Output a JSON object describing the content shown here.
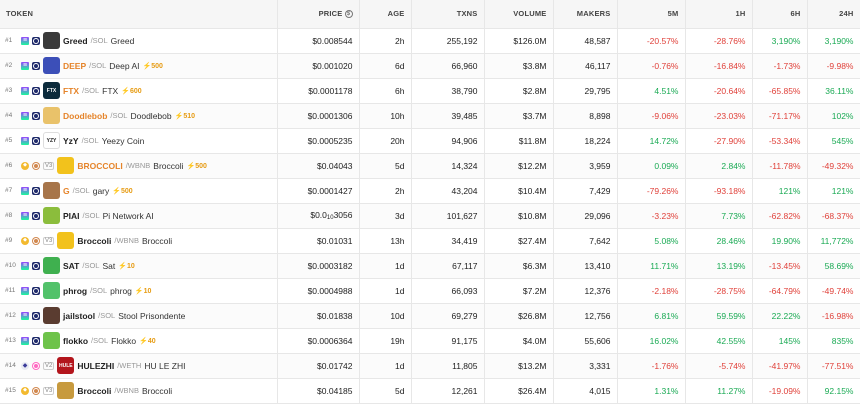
{
  "columns": {
    "token": "TOKEN",
    "price": "PRICE",
    "age": "AGE",
    "txns": "TXNS",
    "volume": "VOLUME",
    "makers": "MAKERS",
    "m5": "5M",
    "h1": "1H",
    "h6": "6H",
    "h24": "24H",
    "price_icon": "$"
  },
  "rows": [
    {
      "rank": "#1",
      "chain": "sol",
      "dex": "ray",
      "version": "",
      "avatar_text": "",
      "avatar_color": "#3a3a3a",
      "symbol": "Greed",
      "hot": false,
      "pair": "/SOL",
      "name": "Greed",
      "boost": "",
      "price": "$0.008544",
      "price_sub": "",
      "age": "2h",
      "txns": "255,192",
      "volume": "$126.0M",
      "makers": "48,587",
      "m5": "-20.57%",
      "m5_dir": "neg",
      "h1": "-28.76%",
      "h1_dir": "neg",
      "h6": "3,190%",
      "h6_dir": "pos",
      "h24": "3,190%",
      "h24_dir": "pos"
    },
    {
      "rank": "#2",
      "chain": "sol",
      "dex": "ray",
      "version": "",
      "avatar_text": "",
      "avatar_color": "#3c4fb8",
      "symbol": "DEEP",
      "hot": true,
      "pair": "/SOL",
      "name": "Deep AI",
      "boost": "500",
      "price": "$0.001020",
      "price_sub": "",
      "age": "6d",
      "txns": "66,960",
      "volume": "$3.8M",
      "makers": "46,117",
      "m5": "-0.76%",
      "m5_dir": "neg",
      "h1": "-16.84%",
      "h1_dir": "neg",
      "h6": "-1.73%",
      "h6_dir": "neg",
      "h24": "-9.98%",
      "h24_dir": "neg"
    },
    {
      "rank": "#3",
      "chain": "sol",
      "dex": "ray",
      "version": "",
      "avatar_text": "FTX",
      "avatar_color": "#0c2b3c",
      "symbol": "FTX",
      "hot": true,
      "pair": "/SOL",
      "name": "FTX",
      "boost": "600",
      "price": "$0.0001178",
      "price_sub": "",
      "age": "6h",
      "txns": "38,790",
      "volume": "$2.8M",
      "makers": "29,795",
      "m5": "4.51%",
      "m5_dir": "pos",
      "h1": "-20.64%",
      "h1_dir": "neg",
      "h6": "-65.85%",
      "h6_dir": "neg",
      "h24": "36.11%",
      "h24_dir": "pos"
    },
    {
      "rank": "#4",
      "chain": "sol",
      "dex": "ray",
      "version": "",
      "avatar_text": "",
      "avatar_color": "#e9c26a",
      "symbol": "Doodlebob",
      "hot": true,
      "pair": "/SOL",
      "name": "Doodlebob",
      "boost": "510",
      "price": "$0.0001306",
      "price_sub": "",
      "age": "10h",
      "txns": "39,485",
      "volume": "$3.7M",
      "makers": "8,898",
      "m5": "-9.06%",
      "m5_dir": "neg",
      "h1": "-23.03%",
      "h1_dir": "neg",
      "h6": "-71.17%",
      "h6_dir": "neg",
      "h24": "102%",
      "h24_dir": "pos"
    },
    {
      "rank": "#5",
      "chain": "sol",
      "dex": "ray",
      "version": "",
      "avatar_text": "YZY",
      "avatar_color": "#ffffff",
      "symbol": "YzY",
      "hot": false,
      "pair": "/SOL",
      "name": "Yeezy Coin",
      "boost": "",
      "price": "$0.0005235",
      "price_sub": "",
      "age": "20h",
      "txns": "94,906",
      "volume": "$11.8M",
      "makers": "18,224",
      "m5": "14.72%",
      "m5_dir": "pos",
      "h1": "-27.90%",
      "h1_dir": "neg",
      "h6": "-53.34%",
      "h6_dir": "neg",
      "h24": "545%",
      "h24_dir": "pos"
    },
    {
      "rank": "#6",
      "chain": "bnb",
      "dex": "pancake",
      "version": "V3",
      "avatar_text": "",
      "avatar_color": "#f2c21c",
      "symbol": "BROCCOLI",
      "hot": true,
      "pair": "/WBNB",
      "name": "Broccoli",
      "boost": "500",
      "price": "$0.04043",
      "price_sub": "",
      "age": "5d",
      "txns": "14,324",
      "volume": "$12.2M",
      "makers": "3,959",
      "m5": "0.09%",
      "m5_dir": "pos",
      "h1": "2.84%",
      "h1_dir": "pos",
      "h6": "-11.78%",
      "h6_dir": "neg",
      "h24": "-49.32%",
      "h24_dir": "neg"
    },
    {
      "rank": "#7",
      "chain": "sol",
      "dex": "ray",
      "version": "",
      "avatar_text": "",
      "avatar_color": "#a7754a",
      "symbol": "G",
      "hot": true,
      "pair": "/SOL",
      "name": "gary",
      "boost": "500",
      "price": "$0.0001427",
      "price_sub": "",
      "age": "2h",
      "txns": "43,204",
      "volume": "$10.4M",
      "makers": "7,429",
      "m5": "-79.26%",
      "m5_dir": "neg",
      "h1": "-93.18%",
      "h1_dir": "neg",
      "h6": "121%",
      "h6_dir": "pos",
      "h24": "121%",
      "h24_dir": "pos"
    },
    {
      "rank": "#8",
      "chain": "sol",
      "dex": "ray",
      "version": "",
      "avatar_text": "",
      "avatar_color": "#8bbd3c",
      "symbol": "PIAI",
      "hot": false,
      "pair": "/SOL",
      "name": "Pi Network AI",
      "boost": "",
      "price": "$0.0",
      "price_sub": "10",
      "price_tail": "3056",
      "age": "3d",
      "txns": "101,627",
      "volume": "$10.8M",
      "makers": "29,096",
      "m5": "-3.23%",
      "m5_dir": "neg",
      "h1": "7.73%",
      "h1_dir": "pos",
      "h6": "-62.82%",
      "h6_dir": "neg",
      "h24": "-68.37%",
      "h24_dir": "neg"
    },
    {
      "rank": "#9",
      "chain": "bnb",
      "dex": "pancake",
      "version": "V3",
      "avatar_text": "",
      "avatar_color": "#f2c21c",
      "symbol": "Broccoli",
      "hot": false,
      "pair": "/WBNB",
      "name": "Broccoli",
      "boost": "",
      "price": "$0.01031",
      "price_sub": "",
      "age": "13h",
      "txns": "34,419",
      "volume": "$27.4M",
      "makers": "7,642",
      "m5": "5.08%",
      "m5_dir": "pos",
      "h1": "28.46%",
      "h1_dir": "pos",
      "h6": "19.90%",
      "h6_dir": "pos",
      "h24": "11,772%",
      "h24_dir": "pos"
    },
    {
      "rank": "#10",
      "chain": "sol",
      "dex": "ray",
      "version": "",
      "avatar_text": "",
      "avatar_color": "#3fb04f",
      "symbol": "SAT",
      "hot": false,
      "pair": "/SOL",
      "name": "Sat",
      "boost": "10",
      "price": "$0.0003182",
      "price_sub": "",
      "age": "1d",
      "txns": "67,117",
      "volume": "$6.3M",
      "makers": "13,410",
      "m5": "11.71%",
      "m5_dir": "pos",
      "h1": "13.19%",
      "h1_dir": "pos",
      "h6": "-13.45%",
      "h6_dir": "neg",
      "h24": "58.69%",
      "h24_dir": "pos"
    },
    {
      "rank": "#11",
      "chain": "sol",
      "dex": "ray",
      "version": "",
      "avatar_text": "",
      "avatar_color": "#52c26a",
      "symbol": "phrog",
      "hot": false,
      "pair": "/SOL",
      "name": "phrog",
      "boost": "10",
      "price": "$0.0004988",
      "price_sub": "",
      "age": "1d",
      "txns": "66,093",
      "volume": "$7.2M",
      "makers": "12,376",
      "m5": "-2.18%",
      "m5_dir": "neg",
      "h1": "-28.75%",
      "h1_dir": "neg",
      "h6": "-64.79%",
      "h6_dir": "neg",
      "h24": "-49.74%",
      "h24_dir": "neg"
    },
    {
      "rank": "#12",
      "chain": "sol",
      "dex": "ray",
      "version": "",
      "avatar_text": "",
      "avatar_color": "#5a3c30",
      "symbol": "jailstool",
      "hot": false,
      "pair": "/SOL",
      "name": "Stool Prisondente",
      "boost": "",
      "price": "$0.01838",
      "price_sub": "",
      "age": "10d",
      "txns": "69,279",
      "volume": "$26.8M",
      "makers": "12,756",
      "m5": "6.81%",
      "m5_dir": "pos",
      "h1": "59.59%",
      "h1_dir": "pos",
      "h6": "22.22%",
      "h6_dir": "pos",
      "h24": "-16.98%",
      "h24_dir": "neg"
    },
    {
      "rank": "#13",
      "chain": "sol",
      "dex": "ray",
      "version": "",
      "avatar_text": "",
      "avatar_color": "#6ec34a",
      "symbol": "flokko",
      "hot": false,
      "pair": "/SOL",
      "name": "Flokko",
      "boost": "40",
      "price": "$0.0006364",
      "price_sub": "",
      "age": "19h",
      "txns": "91,175",
      "volume": "$4.0M",
      "makers": "55,606",
      "m5": "16.02%",
      "m5_dir": "pos",
      "h1": "42.55%",
      "h1_dir": "pos",
      "h6": "145%",
      "h6_dir": "pos",
      "h24": "835%",
      "h24_dir": "pos"
    },
    {
      "rank": "#14",
      "chain": "eth",
      "dex": "uni",
      "version": "V2",
      "avatar_text": "HULE",
      "avatar_color": "#b3151c",
      "symbol": "HULEZHI",
      "hot": false,
      "pair": "/WETH",
      "name": "HU LE ZHI",
      "boost": "",
      "price": "$0.01742",
      "price_sub": "",
      "age": "1d",
      "txns": "11,805",
      "volume": "$13.2M",
      "makers": "3,331",
      "m5": "-1.76%",
      "m5_dir": "neg",
      "h1": "-5.74%",
      "h1_dir": "neg",
      "h6": "-41.97%",
      "h6_dir": "neg",
      "h24": "-77.51%",
      "h24_dir": "neg"
    },
    {
      "rank": "#15",
      "chain": "bnb",
      "dex": "pancake",
      "version": "V3",
      "avatar_text": "",
      "avatar_color": "#c79a3e",
      "symbol": "Broccoli",
      "hot": false,
      "pair": "/WBNB",
      "name": "Broccoli",
      "boost": "",
      "price": "$0.04185",
      "price_sub": "",
      "age": "5d",
      "txns": "12,261",
      "volume": "$26.4M",
      "makers": "4,015",
      "m5": "1.31%",
      "m5_dir": "pos",
      "h1": "11.27%",
      "h1_dir": "pos",
      "h6": "-19.09%",
      "h6_dir": "neg",
      "h24": "92.15%",
      "h24_dir": "pos"
    }
  ]
}
